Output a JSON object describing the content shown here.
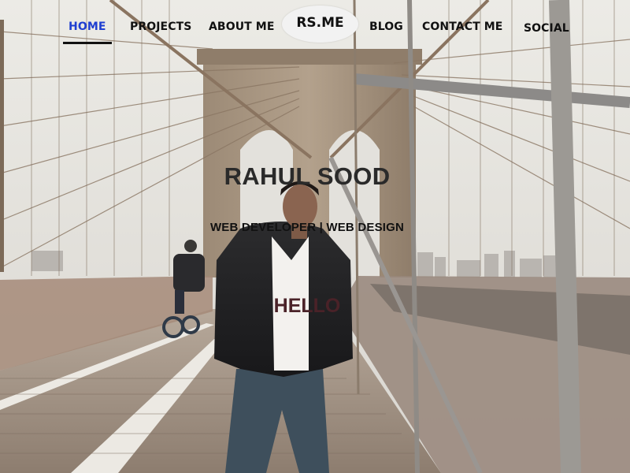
{
  "nav": {
    "items": [
      {
        "label": "HOME",
        "active": true
      },
      {
        "label": "PROJECTS"
      },
      {
        "label": "ABOUT ME"
      },
      {
        "label": "BLOG"
      },
      {
        "label": "CONTACT ME"
      },
      {
        "label": "SOCIAL"
      }
    ],
    "logo": "RS.ME",
    "active_color": "#1f3fd1"
  },
  "hero": {
    "name": "RAHUL SOOD",
    "subtitle": "WEB DEVELOPER | WEB DESIGN",
    "greeting": "HELLO"
  },
  "background": {
    "subject": "person-standing-on-suspension-bridge-photo"
  }
}
